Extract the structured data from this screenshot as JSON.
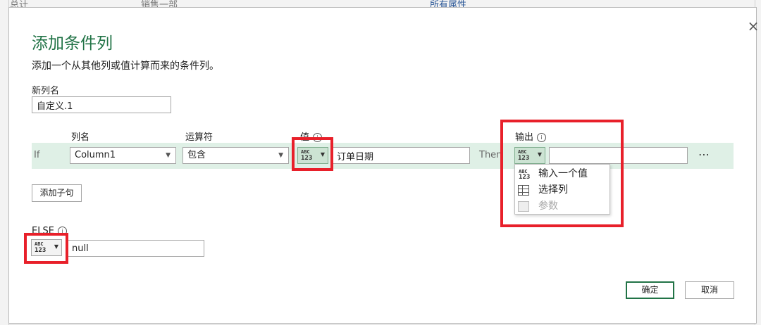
{
  "background": {
    "cell_1": "总计",
    "cell_2": "销售一部",
    "cell_3": "所有属性"
  },
  "dialog": {
    "title": "添加条件列",
    "description": "添加一个从其他列或值计算而来的条件列。",
    "close_icon": "×",
    "new_column_label": "新列名",
    "new_column_value": "自定义.1",
    "headers": {
      "column_name": "列名",
      "operator": "运算符",
      "value": "值",
      "output": "输出"
    },
    "info_glyph": "i",
    "clause": {
      "if_label": "If",
      "column": "Column1",
      "operator": "包含",
      "value": "订单日期",
      "then_label": "Then",
      "output_value": "",
      "more": "⋯"
    },
    "type_icon": {
      "abc": "ABC",
      "num": "123"
    },
    "add_clause_button": "添加子句",
    "else_label": "ELSE",
    "else_value": "null",
    "ok_button": "确定",
    "cancel_button": "取消",
    "output_menu": {
      "items": [
        {
          "label": "输入一个值",
          "icon": "abc-123-icon",
          "disabled": false
        },
        {
          "label": "选择列",
          "icon": "table-icon",
          "disabled": false
        },
        {
          "label": "参数",
          "icon": "parameter-icon",
          "disabled": true
        }
      ]
    }
  },
  "colors": {
    "accent": "#217346",
    "highlight_band": "#dff0e6",
    "annotation_red": "#e8202a"
  }
}
